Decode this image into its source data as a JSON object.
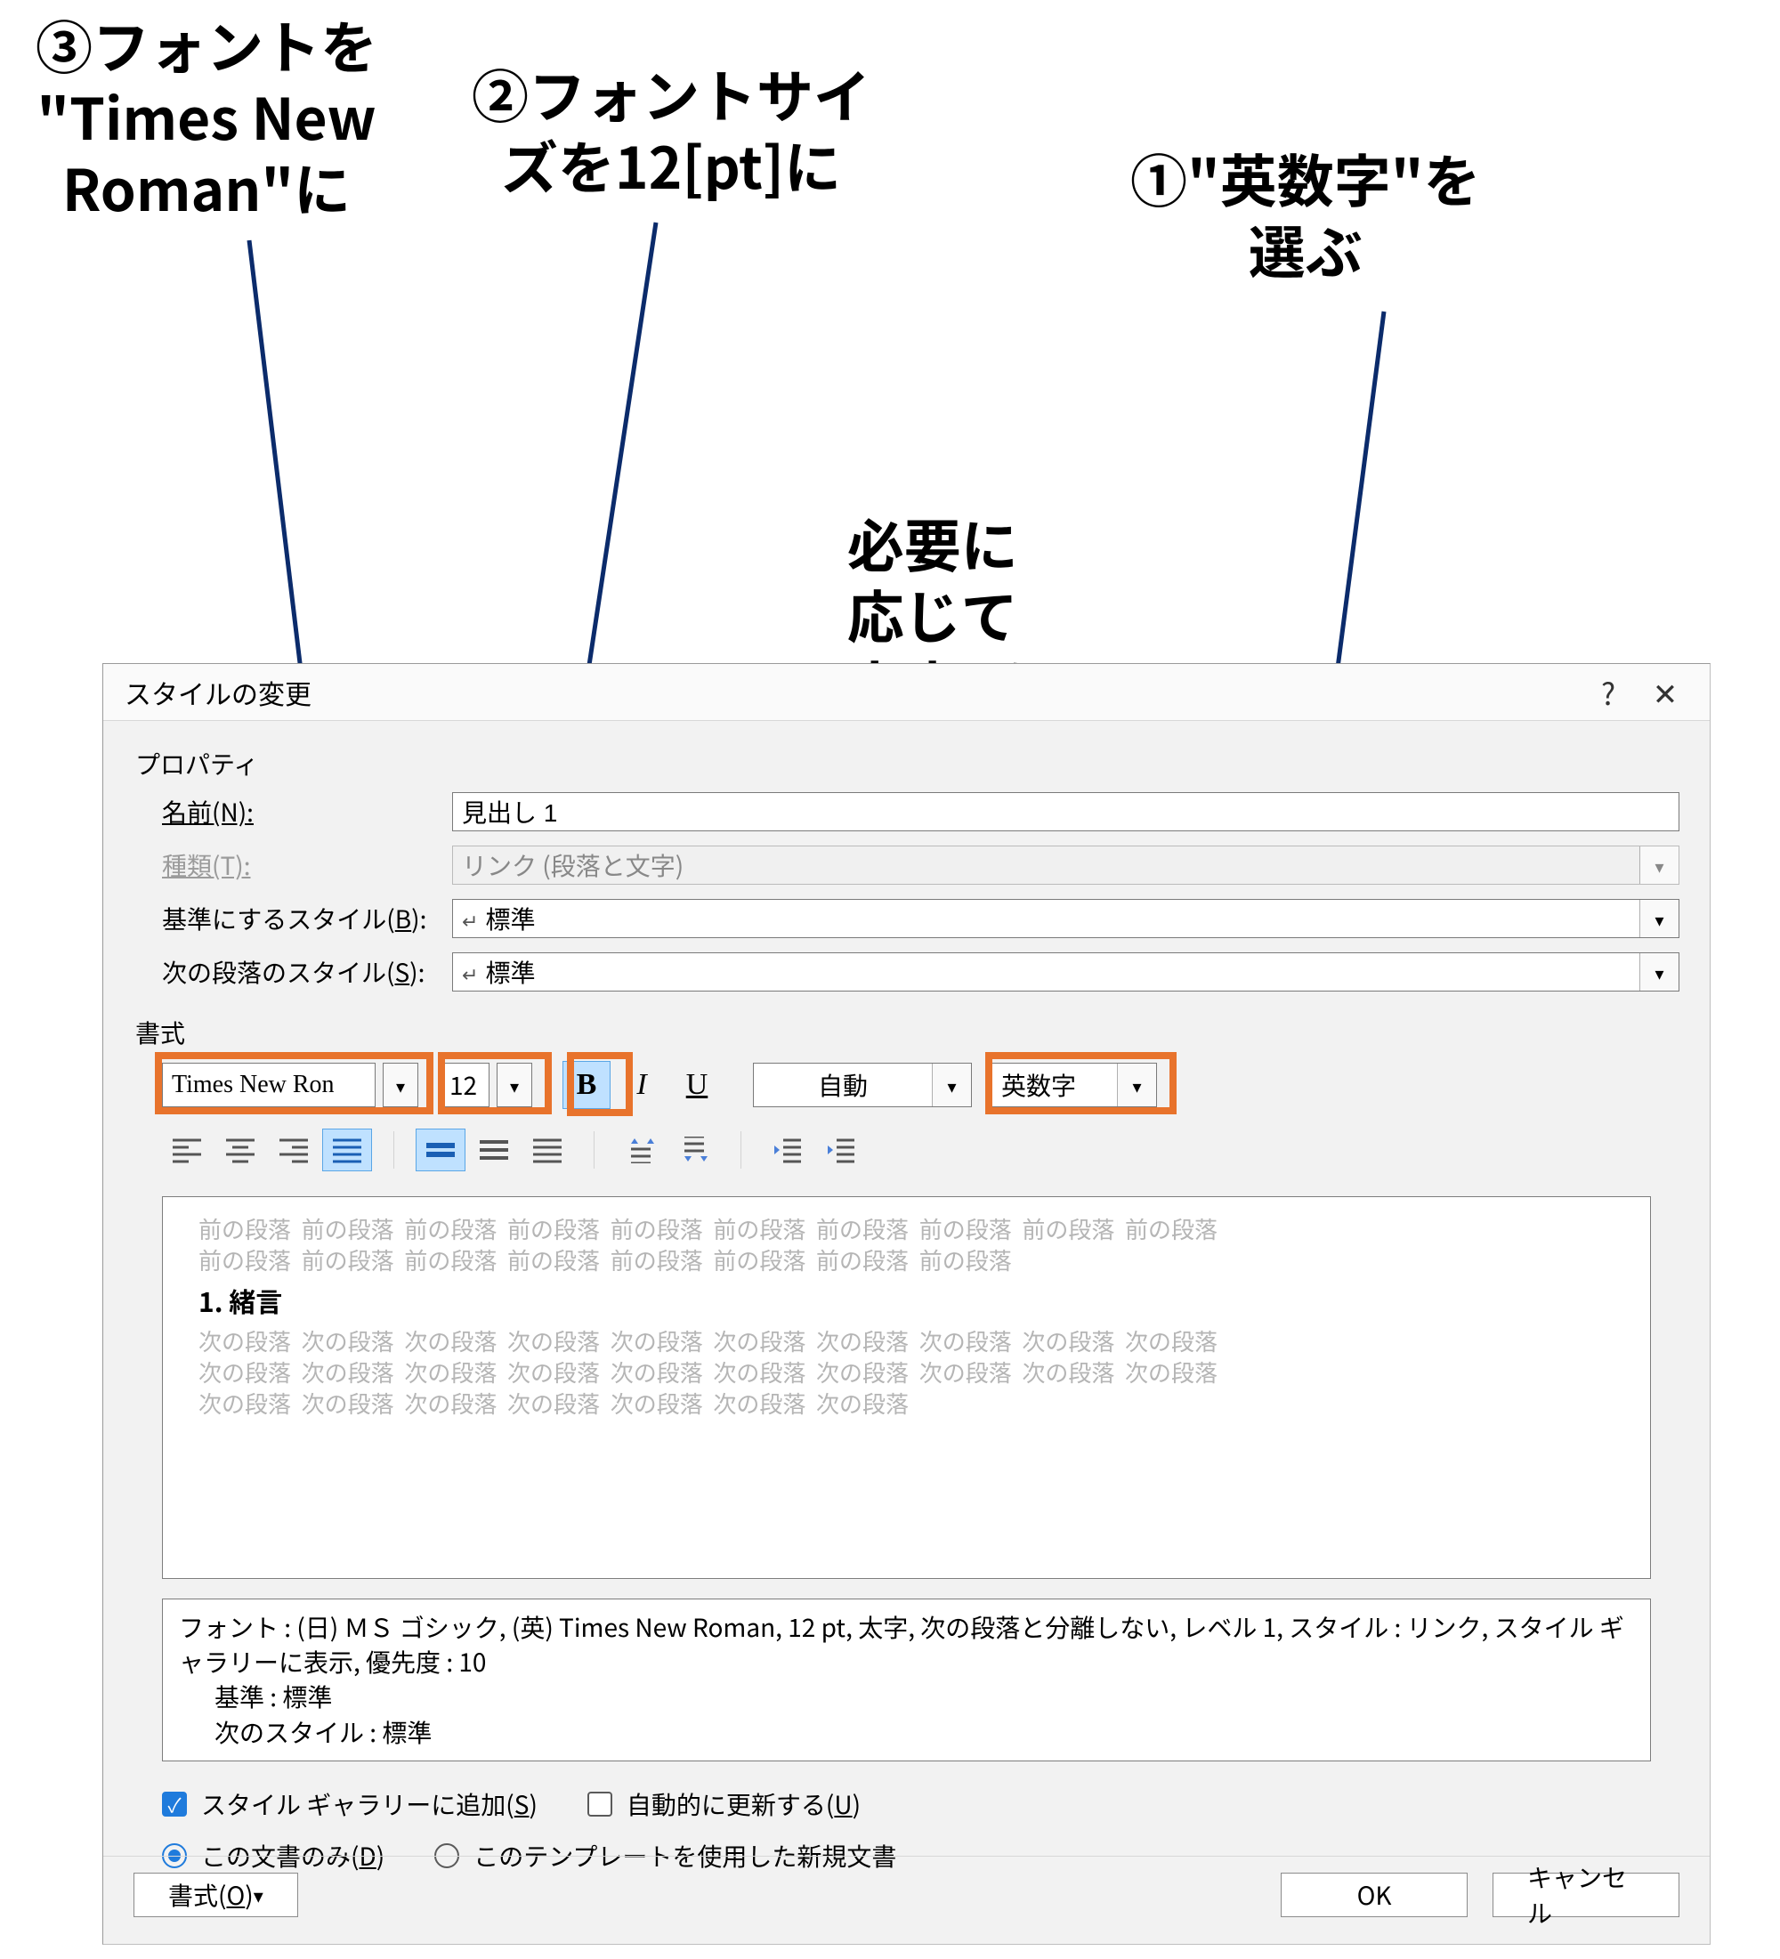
{
  "annotations": {
    "a3": "③フォントを\n\"Times New\nRoman\"に",
    "a2": "②フォントサイ\nズを12[pt]に",
    "a1": "①\"英数字\"を\n選ぶ",
    "bold_note": "必要に\n応じて\n\"太字\"を\n選択"
  },
  "dialog": {
    "title": "スタイルの変更",
    "help": "?",
    "close": "✕",
    "sections": {
      "properties": "プロパティ",
      "format": "書式"
    },
    "fields": {
      "name": {
        "label": "名前(N):",
        "value": "見出し 1"
      },
      "type": {
        "label": "種類(T):",
        "value": "リンク (段落と文字)"
      },
      "based": {
        "label_pre": "基準にするスタイル(",
        "mnemonic": "B",
        "label_post": "):",
        "value": "標準"
      },
      "next": {
        "label_pre": "次の段落のスタイル(",
        "mnemonic": "S",
        "label_post": "):",
        "value": "標準"
      }
    },
    "format_toolbar": {
      "font": "Times New Ron",
      "size": "12",
      "bold_glyph": "B",
      "italic_glyph": "I",
      "underline_glyph": "U",
      "color": "自動",
      "script": "英数字"
    },
    "preview": {
      "prev_para": "前の段落",
      "next_para": "次の段落",
      "sample": "1.  緒言"
    },
    "description": {
      "line1": "フォント : (日) ＭＳ ゴシック, (英) Times New Roman, 12 pt, 太字, 次の段落と分離しない, レベル 1, スタイル : リンク, スタイル ギャラリーに表示, 優先度 : 10",
      "line2": "基準 : 標準",
      "line3": "次のスタイル : 標準"
    },
    "options": {
      "gallery_pre": "スタイル ギャラリーに追加(",
      "gallery_m": "S",
      "gallery_post": ")",
      "autoupd_pre": "自動的に更新する(",
      "autoupd_m": "U",
      "autoupd_post": ")",
      "doc_only_pre": "この文書のみ(",
      "doc_only_m": "D",
      "doc_only_post": ")",
      "template": "このテンプレートを使用した新規文書"
    },
    "buttons": {
      "format_pre": "書式(",
      "format_m": "O",
      "format_post": ")",
      "ok": "OK",
      "cancel": "キャンセル"
    }
  }
}
